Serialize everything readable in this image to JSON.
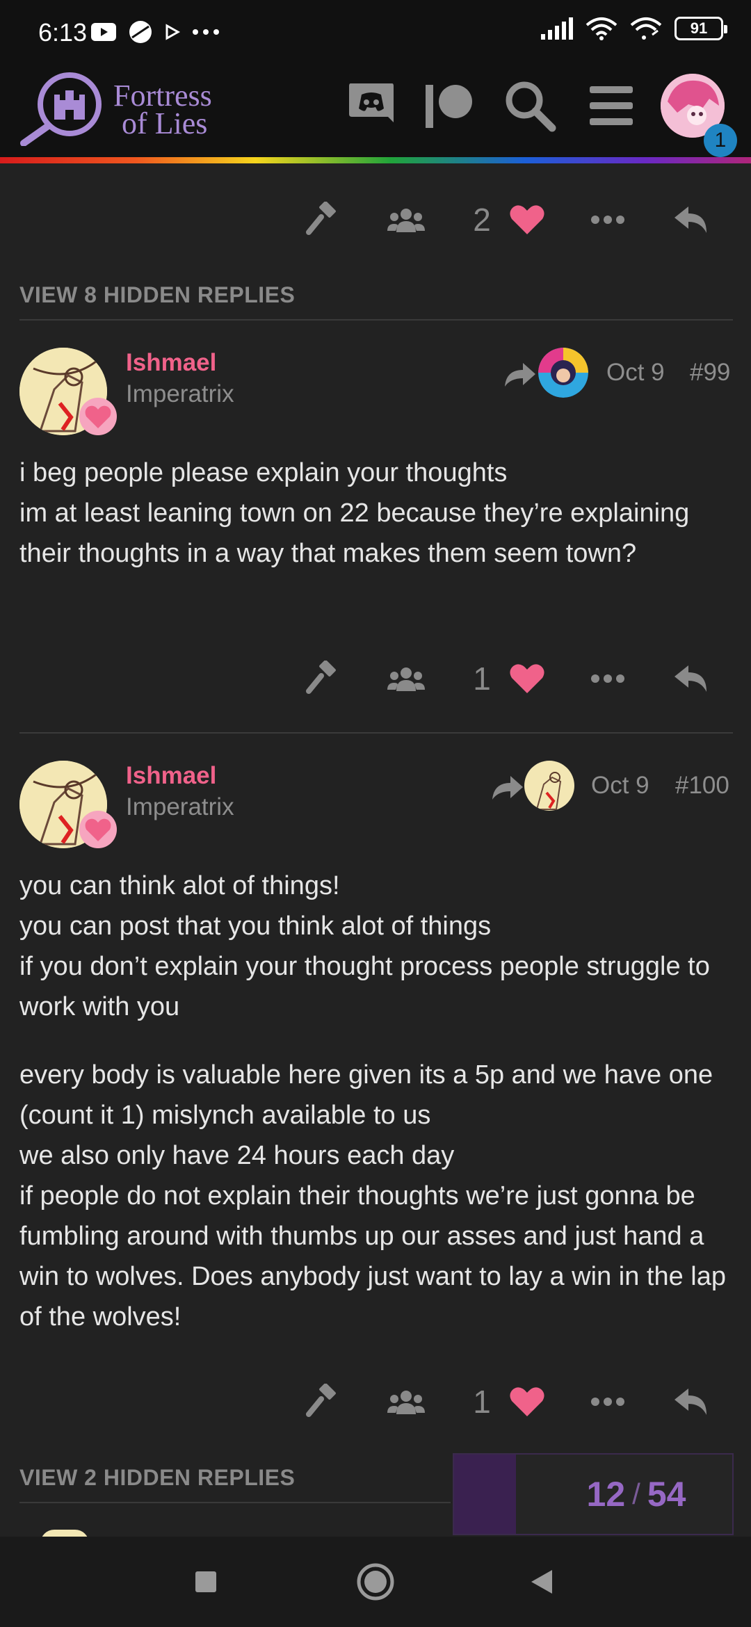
{
  "status_bar": {
    "time": "6:13",
    "battery": "91"
  },
  "header": {
    "logo_line1": "Fortress",
    "logo_line2": "of Lies",
    "notification_count": "1"
  },
  "top_actions": {
    "like_count": "2"
  },
  "hidden_replies_top": "VIEW 8 HIDDEN REPLIES",
  "posts": [
    {
      "username": "Ishmael",
      "user_title": "Imperatrix",
      "date": "Oct 9",
      "number": "#99",
      "paragraphs": [
        "i beg people please explain your thoughts\nim at least leaning town on 22 because they’re explaining their thoughts in a way that makes them seem town?"
      ],
      "like_count": "1"
    },
    {
      "username": "Ishmael",
      "user_title": "Imperatrix",
      "date": "Oct 9",
      "number": "#100",
      "paragraphs": [
        "you can think alot of things!\nyou can post that you think alot of things\nif you don’t explain your thought process people struggle to work with you",
        "every body is valuable here given its a 5p and we have one (count it 1) mislynch available to us\nwe also only have 24 hours each day\nif people do not explain their thoughts we’re just gonna be fumbling around with thumbs up our asses and just hand a win to wolves. Does anybody just want to lay a win in the lap of the wolves!"
      ],
      "like_count": "1"
    }
  ],
  "hidden_replies_bottom": "VIEW 2 HIDDEN REPLIES",
  "progress": {
    "current": "12",
    "separator": "/",
    "total": "54",
    "fraction": 0.222
  },
  "colors": {
    "accent": "#9668c4",
    "username": "#f0628a",
    "heart": "#f0628a",
    "background": "#222222",
    "notification": "#1f84c2"
  },
  "icons": [
    "youtube-icon",
    "app-icon",
    "play-icon",
    "more-dots-icon",
    "signal-icon",
    "wifi-icon",
    "wifi-link-icon",
    "discord-icon",
    "patreon-icon",
    "search-icon",
    "hamburger-icon",
    "gavel-icon",
    "group-icon",
    "heart-icon",
    "ellipsis-icon",
    "reply-icon",
    "reply-to-arrow-icon",
    "square-nav-icon",
    "circle-nav-icon",
    "back-nav-icon"
  ]
}
